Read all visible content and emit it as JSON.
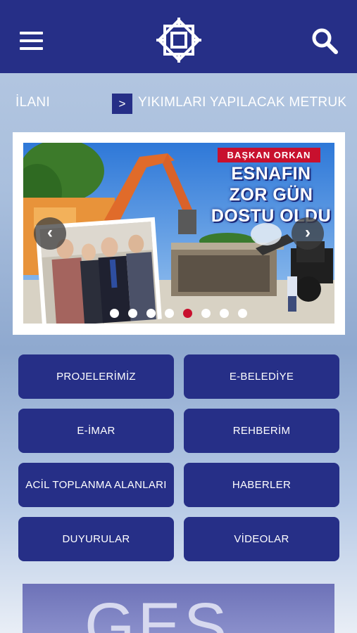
{
  "header": {
    "menu_icon": "hamburger-menu-icon",
    "logo_icon": "municipality-logo-icon",
    "search_icon": "search-icon",
    "background_color": "#262f87"
  },
  "ticker": {
    "items": [
      "İLANI",
      "YIKIMLARI YAPILACAK METRUK"
    ],
    "arrow": ">"
  },
  "slider": {
    "banner_tag": "BAŞKAN ORKAN",
    "banner_lines": [
      "ESNAFIN",
      "ZOR GÜN",
      "DOSTU OLDU"
    ],
    "prev": "‹",
    "next": "›",
    "dot_count": 8,
    "active_dot": 5,
    "accent_color": "#c8102e"
  },
  "tiles": [
    {
      "label": "PROJELERİMİZ"
    },
    {
      "label": "E-BELEDİYE"
    },
    {
      "label": "E-İMAR"
    },
    {
      "label": "REHBERİM"
    },
    {
      "label": "ACİL TOPLANMA ALANLARI"
    },
    {
      "label": "HABERLER"
    },
    {
      "label": "DUYURULAR"
    },
    {
      "label": "VİDEOLAR"
    }
  ],
  "bottom_banner": {
    "text": "GES"
  }
}
